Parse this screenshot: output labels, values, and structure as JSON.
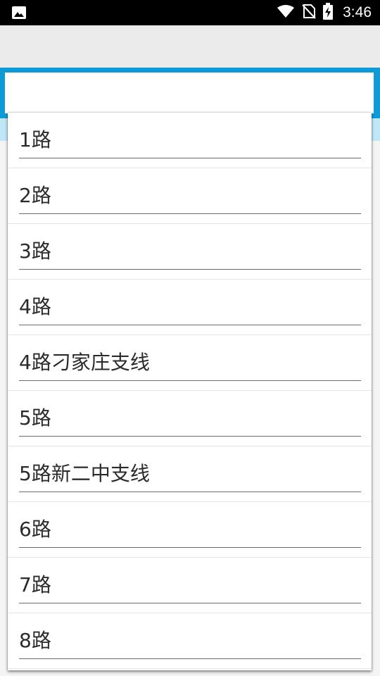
{
  "status_bar": {
    "time": "3:46",
    "icons": [
      "image-icon",
      "wifi-icon",
      "no-sim-icon",
      "battery-charging-icon"
    ]
  },
  "search": {
    "value": "",
    "placeholder": ""
  },
  "dropdown": {
    "items": [
      {
        "label": "1路"
      },
      {
        "label": "2路"
      },
      {
        "label": "3路"
      },
      {
        "label": "4路"
      },
      {
        "label": "4路刁家庄支线"
      },
      {
        "label": "5路"
      },
      {
        "label": "5路新二中支线"
      },
      {
        "label": "6路"
      },
      {
        "label": "7路"
      },
      {
        "label": "8路"
      }
    ]
  },
  "colors": {
    "accent": "#0e9ad7",
    "status_bar": "#000000",
    "toolbar": "#ebebeb"
  }
}
